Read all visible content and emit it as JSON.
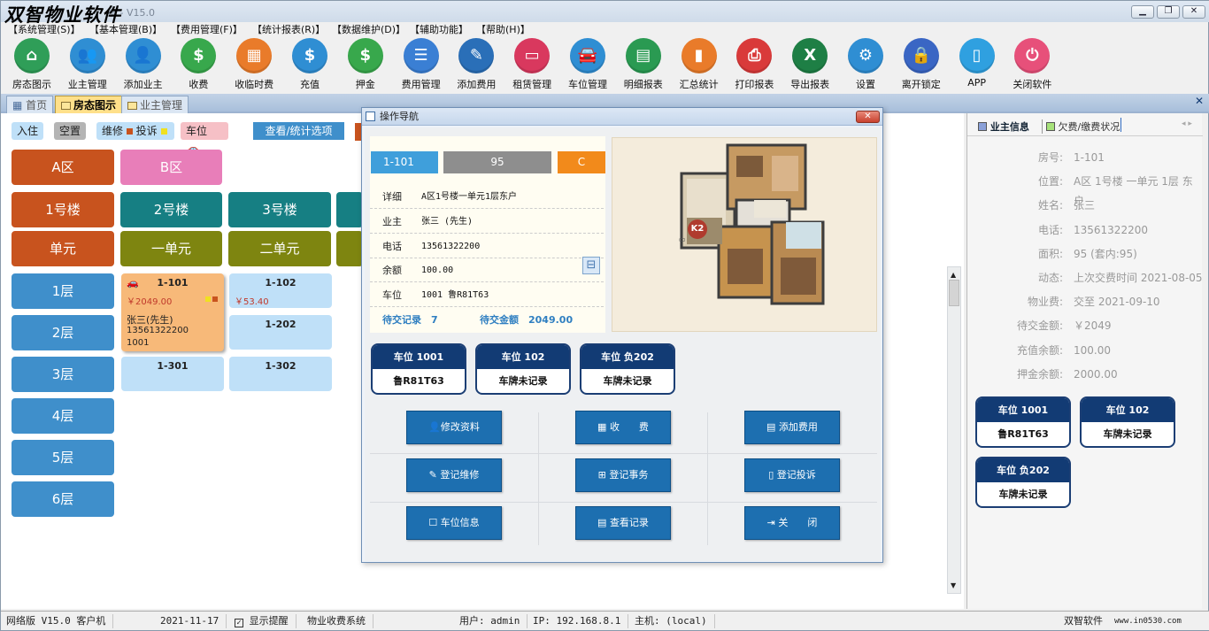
{
  "app": {
    "watermark": "双智物业软件",
    "title": "统 - V15.0"
  },
  "window_controls": {
    "minimize": "▁",
    "restore": "❐",
    "close": "✕"
  },
  "menu": [
    "【系统管理(S)】",
    "【基本管理(B)】",
    "【费用管理(F)】",
    "【统计报表(R)】",
    "【数据维护(D)】",
    "【辅助功能】",
    "【帮助(H)】"
  ],
  "toolbar": [
    {
      "label": "房态图示",
      "icon": "house-icon",
      "color": "#2f9e58"
    },
    {
      "label": "业主管理",
      "icon": "users-icon",
      "color": "#2f8ed3"
    },
    {
      "label": "添加业主",
      "icon": "user-add-icon",
      "color": "#2f8ed3"
    },
    {
      "label": "收费",
      "icon": "dollar-icon",
      "color": "#38a84c"
    },
    {
      "label": "收临时费",
      "icon": "calculator-icon",
      "color": "#e97b2a"
    },
    {
      "label": "充值",
      "icon": "money-bag-icon",
      "color": "#2f8ed3"
    },
    {
      "label": "押金",
      "icon": "money-bag-icon",
      "color": "#38a84c"
    },
    {
      "label": "费用管理",
      "icon": "list-icon",
      "color": "#3a7fd4"
    },
    {
      "label": "添加费用",
      "icon": "edit-icon",
      "color": "#2a6fb8"
    },
    {
      "label": "租赁管理",
      "icon": "card-icon",
      "color": "#d9385e"
    },
    {
      "label": "车位管理",
      "icon": "car-icon",
      "color": "#2f8ed3"
    },
    {
      "label": "明细报表",
      "icon": "sheet-icon",
      "color": "#2a9a52"
    },
    {
      "label": "汇总统计",
      "icon": "bar-chart-icon",
      "color": "#e97b2a"
    },
    {
      "label": "打印报表",
      "icon": "printer-icon",
      "color": "#d93a3a"
    },
    {
      "label": "导出报表",
      "icon": "excel-icon",
      "color": "#1e7f45"
    },
    {
      "label": "设置",
      "icon": "gear-icon",
      "color": "#2f8ed3"
    },
    {
      "label": "离开锁定",
      "icon": "lock-icon",
      "color": "#3a66c4"
    },
    {
      "label": "APP",
      "icon": "phone-icon",
      "color": "#2fa0e0"
    },
    {
      "label": "关闭软件",
      "icon": "power-icon",
      "color": "#e7507a"
    }
  ],
  "tabs": {
    "home": "首页",
    "house_map": "房态图示",
    "owner_mgmt": "业主管理",
    "close": "✕"
  },
  "legend": {
    "checkin": "入住",
    "vacant": "空置",
    "repair": "维修",
    "complaint": "投诉",
    "parking": "车位",
    "query": "查看/统计选项"
  },
  "areas": [
    "A区",
    "B区"
  ],
  "buildings": [
    "1号楼",
    "2号楼",
    "3号楼"
  ],
  "units": [
    "单元",
    "一单元",
    "二单元"
  ],
  "floors": [
    "1层",
    "2层",
    "3层",
    "4层",
    "5层",
    "6层"
  ],
  "rooms": [
    {
      "no": "1-101",
      "amount": "￥2049.00",
      "owner": "张三(先生)",
      "phone": "13561322200",
      "code": "1001"
    },
    {
      "no": "1-102",
      "amount": "￥53.40"
    },
    {
      "no": "1-202"
    },
    {
      "no": "1-301"
    },
    {
      "no": "1-302"
    }
  ],
  "dialog": {
    "title": "操作导航",
    "room": "1-101",
    "area": "95",
    "type": "C",
    "info": [
      {
        "k": "详细",
        "v": "A区1号楼一单元1层东户"
      },
      {
        "k": "业主",
        "v": "张三 (先生)"
      },
      {
        "k": "电话",
        "v": "13561322200"
      },
      {
        "k": "余额",
        "v": "100.00"
      },
      {
        "k": "车位",
        "v": "1001 鲁R81T63"
      }
    ],
    "pending_label": "待交记录",
    "pending_count": "7",
    "pending_amount_label": "待交金额",
    "pending_amount": "2049.00",
    "floorplan_label": "K2",
    "parking": [
      {
        "title": "车位 1001",
        "plate": "鲁R81T63"
      },
      {
        "title": "车位 102",
        "plate": "车牌未记录"
      },
      {
        "title": "车位 负202",
        "plate": "车牌未记录"
      }
    ],
    "actions": [
      "修改资料",
      "收　　费",
      "添加费用",
      "登记维修",
      "登记事务",
      "登记投诉",
      "车位信息",
      "查看记录",
      "关　　闭"
    ]
  },
  "right": {
    "tab_owner": "业主信息",
    "tab_arrears": "欠费/缴费状况",
    "rows": [
      {
        "k": "房号:",
        "v": "1-101"
      },
      {
        "k": "位置:",
        "v": "A区 1号楼 一单元 1层 东户"
      },
      {
        "k": "姓名:",
        "v": "张三"
      },
      {
        "k": "电话:",
        "v": "13561322200"
      },
      {
        "k": "面积:",
        "v": "95 (套内:95)"
      },
      {
        "k": "动态:",
        "v": "上次交费时间 2021-08-05"
      },
      {
        "k": "物业费:",
        "v": "交至 2021-09-10"
      },
      {
        "k": "待交金额:",
        "v": "￥2049"
      },
      {
        "k": "充值余额:",
        "v": "100.00"
      },
      {
        "k": "押金余额:",
        "v": "2000.00"
      }
    ],
    "parking": [
      {
        "title": "车位 1001",
        "plate": "鲁R81T63"
      },
      {
        "title": "车位 102",
        "plate": "车牌未记录"
      },
      {
        "title": "车位 负202",
        "plate": "车牌未记录"
      }
    ]
  },
  "status": {
    "edition": "网络版 V15.0  客户机",
    "date": "2021-11-17",
    "reminder": "显示提醒",
    "system": "物业收费系统",
    "user": "用户: admin",
    "ip": "IP: 192.168.8.1",
    "host": "主机: (local)",
    "vendor": "双智软件",
    "site": "www.in0530.com"
  },
  "colors": {
    "area_a": "#c8531e",
    "area_b": "#e87eb9",
    "building_1": "#c8531e",
    "building_teal": "#167f83",
    "unit_olive": "#7e8510",
    "floor_blue": "#3f8fcb",
    "room_occupied": "#f7b979",
    "room_vacant": "#bfe0f8",
    "accent_navy": "#123b74"
  }
}
